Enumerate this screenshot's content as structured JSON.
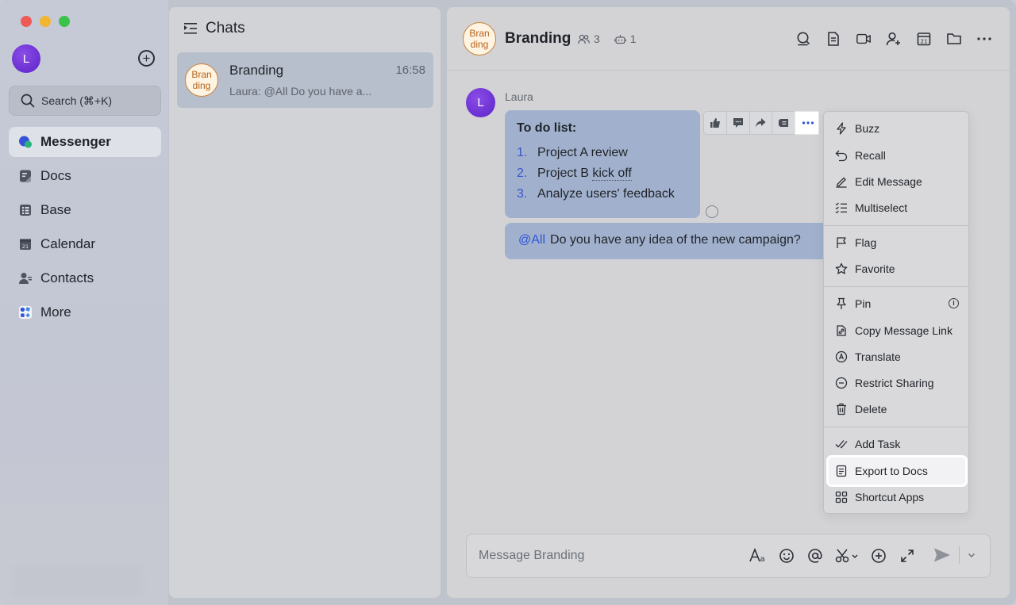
{
  "sidebar": {
    "avatar_initial": "L",
    "search_placeholder": "Search (⌘+K)",
    "items": [
      {
        "label": "Messenger",
        "icon": "messenger-icon",
        "active": true
      },
      {
        "label": "Docs",
        "icon": "docs-icon"
      },
      {
        "label": "Base",
        "icon": "base-icon"
      },
      {
        "label": "Calendar",
        "icon": "calendar-icon"
      },
      {
        "label": "Contacts",
        "icon": "contacts-icon"
      },
      {
        "label": "More",
        "icon": "more-apps-icon"
      }
    ]
  },
  "chat_list": {
    "title": "Chats",
    "chats": [
      {
        "avatar_text": "Bran ding",
        "name": "Branding",
        "time": "16:58",
        "preview": "Laura: @All Do you have a..."
      }
    ]
  },
  "conversation": {
    "avatar_text": "Bran ding",
    "title": "Branding",
    "member_count": "3",
    "bot_count": "1",
    "header_icons": [
      "search-icon",
      "doc-icon",
      "video-call-icon",
      "add-member-icon",
      "calendar-icon",
      "folder-icon",
      "more-icon"
    ],
    "sender_initial": "L",
    "sender_name": "Laura",
    "todo": {
      "title": "To do list:",
      "items": [
        {
          "num": "1.",
          "text": "Project A review"
        },
        {
          "num": "2.",
          "text_a": "Project B ",
          "text_b": "kick off"
        },
        {
          "num": "3.",
          "text": "Analyze users' feedback"
        }
      ]
    },
    "message2": {
      "mention": "@All",
      "text": "Do you have any idea of the new campaign?"
    },
    "reaction_bar": [
      "thumbs-up-icon",
      "reply-icon",
      "forward-icon",
      "quote-icon",
      "more-icon"
    ]
  },
  "menu": {
    "groups": [
      [
        {
          "label": "Buzz",
          "icon": "lightning-icon"
        },
        {
          "label": "Recall",
          "icon": "undo-icon"
        },
        {
          "label": "Edit Message",
          "icon": "pencil-icon"
        },
        {
          "label": "Multiselect",
          "icon": "checklist-icon"
        }
      ],
      [
        {
          "label": "Flag",
          "icon": "flag-icon"
        },
        {
          "label": "Favorite",
          "icon": "star-icon"
        }
      ],
      [
        {
          "label": "Pin",
          "icon": "pin-icon"
        },
        {
          "label": "Copy Message Link",
          "icon": "link-icon"
        },
        {
          "label": "Translate",
          "icon": "translate-icon"
        },
        {
          "label": "Restrict Sharing",
          "icon": "restrict-icon"
        },
        {
          "label": "Delete",
          "icon": "trash-icon"
        }
      ],
      [
        {
          "label": "Add Task",
          "icon": "task-icon"
        },
        {
          "label": "Export to Docs",
          "icon": "doc-export-icon",
          "highlighted": true
        },
        {
          "label": "Shortcut Apps",
          "icon": "grid-icon"
        }
      ]
    ]
  },
  "composer": {
    "placeholder": "Message Branding",
    "tools": [
      "format-text-icon",
      "emoji-icon",
      "mention-icon",
      "screenshot-icon",
      "plus-icon",
      "expand-icon"
    ]
  },
  "colors": {
    "accent": "#2f54d6",
    "bubble": "#a1b1cd",
    "avatar_purple": "#6a2fd6",
    "brand_avatar_border": "#c9843b"
  }
}
